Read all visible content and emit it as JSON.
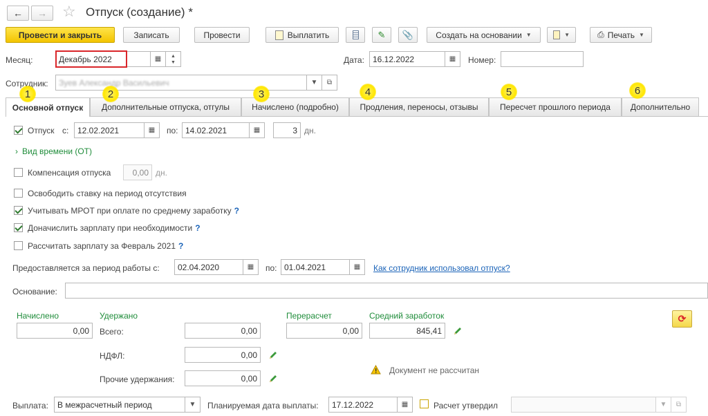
{
  "window": {
    "title": "Отпуск (создание) *"
  },
  "toolbar": {
    "post_close": "Провести и закрыть",
    "save": "Записать",
    "post": "Провести",
    "pay": "Выплатить",
    "create_based": "Создать на основании",
    "print": "Печать"
  },
  "header": {
    "month_label": "Месяц:",
    "month_value": "Декабрь 2022",
    "date_label": "Дата:",
    "date_value": "16.12.2022",
    "number_label": "Номер:",
    "number_value": "",
    "employee_label": "Сотрудник:",
    "employee_value": "Зуев Александр Васильевич"
  },
  "tabs": [
    {
      "label": "Основной отпуск",
      "badge": "1"
    },
    {
      "label": "Дополнительные отпуска, отгулы",
      "badge": "2"
    },
    {
      "label": "Начислено (подробно)",
      "badge": "3"
    },
    {
      "label": "Продления, переносы, отзывы",
      "badge": "4"
    },
    {
      "label": "Пересчет прошлого периода",
      "badge": "5"
    },
    {
      "label": "Дополнительно",
      "badge": "6"
    }
  ],
  "vacation": {
    "label": "Отпуск",
    "from_label": "с:",
    "from": "12.02.2021",
    "to_label": "по:",
    "to": "14.02.2021",
    "days": "3",
    "days_unit": "дн.",
    "time_kind": "Вид времени (ОТ)"
  },
  "compensation": {
    "label": "Компенсация отпуска",
    "value": "0,00",
    "unit": "дн."
  },
  "options": {
    "release_rate": "Освободить ставку на период отсутствия",
    "mrot": "Учитывать МРОТ при оплате по среднему заработку",
    "accrue_salary": "Доначислить зарплату при необходимости",
    "calc_salary": "Рассчитать зарплату за Февраль 2021",
    "help": "?"
  },
  "work_period": {
    "label": "Предоставляется за период работы с:",
    "from": "02.04.2020",
    "to_label": "по:",
    "to": "01.04.2021",
    "link": "Как сотрудник использовал отпуск?"
  },
  "basis": {
    "label": "Основание:",
    "value": ""
  },
  "totals": {
    "accrued_label": "Начислено",
    "accrued": "0,00",
    "withheld_label": "Удержано",
    "total_label": "Всего:",
    "total": "0,00",
    "ndfl_label": "НДФЛ:",
    "ndfl": "0,00",
    "other_label": "Прочие удержания:",
    "other": "0,00",
    "recalc_label": "Перерасчет",
    "recalc": "0,00",
    "avg_label": "Средний заработок",
    "avg": "845,41",
    "warning": "Документ не рассчитан"
  },
  "payment": {
    "label": "Выплата:",
    "value": "В межрасчетный период",
    "planned_label": "Планируемая дата выплаты:",
    "planned": "17.12.2022",
    "approved_label": "Расчет утвердил",
    "approved_value": ""
  },
  "colors": {
    "accent": "#f3c400",
    "green": "#1f8c3a",
    "link": "#1a63b8",
    "highlight": "#d9252a"
  }
}
